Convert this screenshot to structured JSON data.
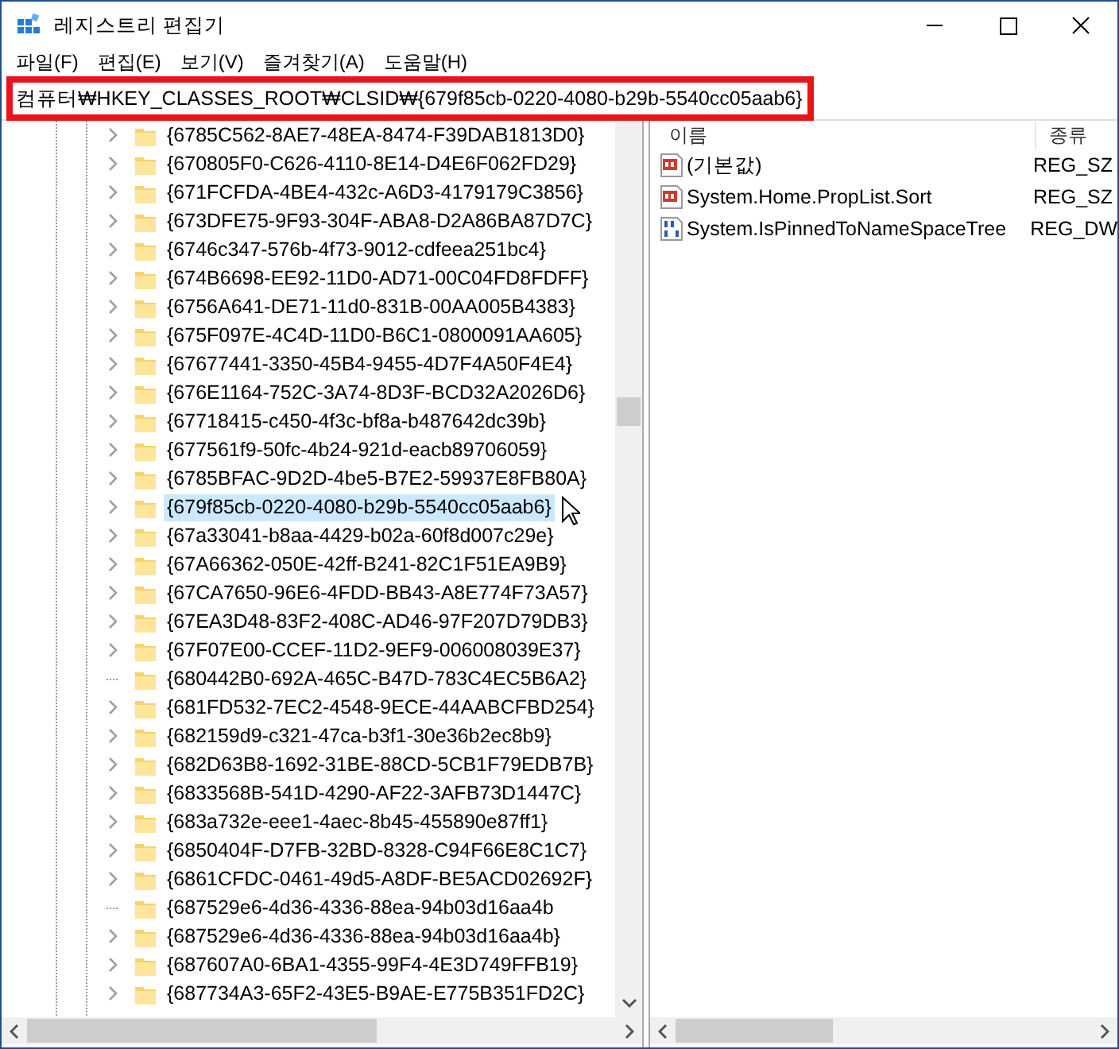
{
  "window": {
    "title": "레지스트리 편집기"
  },
  "menu": [
    "파일(F)",
    "편집(E)",
    "보기(V)",
    "즐겨찾기(A)",
    "도움말(H)"
  ],
  "address": {
    "value": "컴퓨터₩HKEY_CLASSES_ROOT₩CLSID₩{679f85cb-0220-4080-b29b-5540cc05aab6}"
  },
  "tree": {
    "items": [
      {
        "label": "{6785C562-8AE7-48EA-8474-F39DAB1813D0}",
        "expandable": true,
        "selected": false
      },
      {
        "label": "{670805F0-C626-4110-8E14-D4E6F062FD29}",
        "expandable": true,
        "selected": false
      },
      {
        "label": "{671FCFDA-4BE4-432c-A6D3-4179179C3856}",
        "expandable": true,
        "selected": false
      },
      {
        "label": "{673DFE75-9F93-304F-ABA8-D2A86BA87D7C}",
        "expandable": true,
        "selected": false
      },
      {
        "label": "{6746c347-576b-4f73-9012-cdfeea251bc4}",
        "expandable": true,
        "selected": false
      },
      {
        "label": "{674B6698-EE92-11D0-AD71-00C04FD8FDFF}",
        "expandable": true,
        "selected": false
      },
      {
        "label": "{6756A641-DE71-11d0-831B-00AA005B4383}",
        "expandable": true,
        "selected": false
      },
      {
        "label": "{675F097E-4C4D-11D0-B6C1-0800091AA605}",
        "expandable": true,
        "selected": false
      },
      {
        "label": "{67677441-3350-45B4-9455-4D7F4A50F4E4}",
        "expandable": true,
        "selected": false
      },
      {
        "label": "{676E1164-752C-3A74-8D3F-BCD32A2026D6}",
        "expandable": true,
        "selected": false
      },
      {
        "label": "{67718415-c450-4f3c-bf8a-b487642dc39b}",
        "expandable": true,
        "selected": false
      },
      {
        "label": "{677561f9-50fc-4b24-921d-eacb89706059}",
        "expandable": true,
        "selected": false
      },
      {
        "label": "{6785BFAC-9D2D-4be5-B7E2-59937E8FB80A}",
        "expandable": true,
        "selected": false
      },
      {
        "label": "{679f85cb-0220-4080-b29b-5540cc05aab6}",
        "expandable": true,
        "selected": true
      },
      {
        "label": "{67a33041-b8aa-4429-b02a-60f8d007c29e}",
        "expandable": true,
        "selected": false
      },
      {
        "label": "{67A66362-050E-42ff-B241-82C1F51EA9B9}",
        "expandable": true,
        "selected": false
      },
      {
        "label": "{67CA7650-96E6-4FDD-BB43-A8E774F73A57}",
        "expandable": true,
        "selected": false
      },
      {
        "label": "{67EA3D48-83F2-408C-AD46-97F207D79DB3}",
        "expandable": true,
        "selected": false
      },
      {
        "label": "{67F07E00-CCEF-11D2-9EF9-006008039E37}",
        "expandable": true,
        "selected": false
      },
      {
        "label": "{680442B0-692A-465C-B47D-783C4EC5B6A2}",
        "expandable": false,
        "selected": false
      },
      {
        "label": "{681FD532-7EC2-4548-9ECE-44AABCFBD254}",
        "expandable": true,
        "selected": false
      },
      {
        "label": "{682159d9-c321-47ca-b3f1-30e36b2ec8b9}",
        "expandable": true,
        "selected": false
      },
      {
        "label": "{682D63B8-1692-31BE-88CD-5CB1F79EDB7B}",
        "expandable": true,
        "selected": false
      },
      {
        "label": "{6833568B-541D-4290-AF22-3AFB73D1447C}",
        "expandable": true,
        "selected": false
      },
      {
        "label": "{683a732e-eee1-4aec-8b45-455890e87ff1}",
        "expandable": true,
        "selected": false
      },
      {
        "label": "{6850404F-D7FB-32BD-8328-C94F66E8C1C7}",
        "expandable": true,
        "selected": false
      },
      {
        "label": "{6861CFDC-0461-49d5-A8DF-BE5ACD02692F}",
        "expandable": true,
        "selected": false
      },
      {
        "label": "{687529e6-4d36-4336-88ea-94b03d16aa4b",
        "expandable": false,
        "selected": false
      },
      {
        "label": "{687529e6-4d36-4336-88ea-94b03d16aa4b}",
        "expandable": true,
        "selected": false
      },
      {
        "label": "{687607A0-6BA1-4355-99F4-4E3D749FFB19}",
        "expandable": true,
        "selected": false
      },
      {
        "label": "{687734A3-65F2-43E5-B9AE-E775B351FD2C}",
        "expandable": true,
        "selected": false
      }
    ]
  },
  "values": {
    "columns": [
      "이름",
      "종류"
    ],
    "rows": [
      {
        "kind": "string",
        "name": "(기본값)",
        "type": "REG_SZ"
      },
      {
        "kind": "string",
        "name": "System.Home.PropList.Sort",
        "type": "REG_SZ"
      },
      {
        "kind": "binary",
        "name": "System.IsPinnedToNameSpaceTree",
        "type": "REG_DW"
      }
    ]
  }
}
